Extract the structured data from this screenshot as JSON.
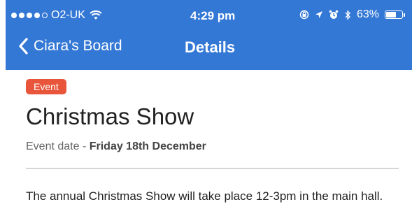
{
  "status_bar": {
    "carrier": "O2-UK",
    "signal_bars_filled": 4,
    "signal_bars_total": 5,
    "time": "4:29 pm",
    "battery_percent": "63%",
    "battery_level": 0.63
  },
  "nav": {
    "back_label": "Ciara's Board",
    "title": "Details"
  },
  "colors": {
    "header": "#3478d6",
    "badge": "#e8553b"
  },
  "event": {
    "badge": "Event",
    "title": "Christmas Show",
    "date_prefix": "Event date - ",
    "date": "Friday 18th December",
    "description": "The annual Christmas Show will take place 12-3pm in the main hall."
  }
}
